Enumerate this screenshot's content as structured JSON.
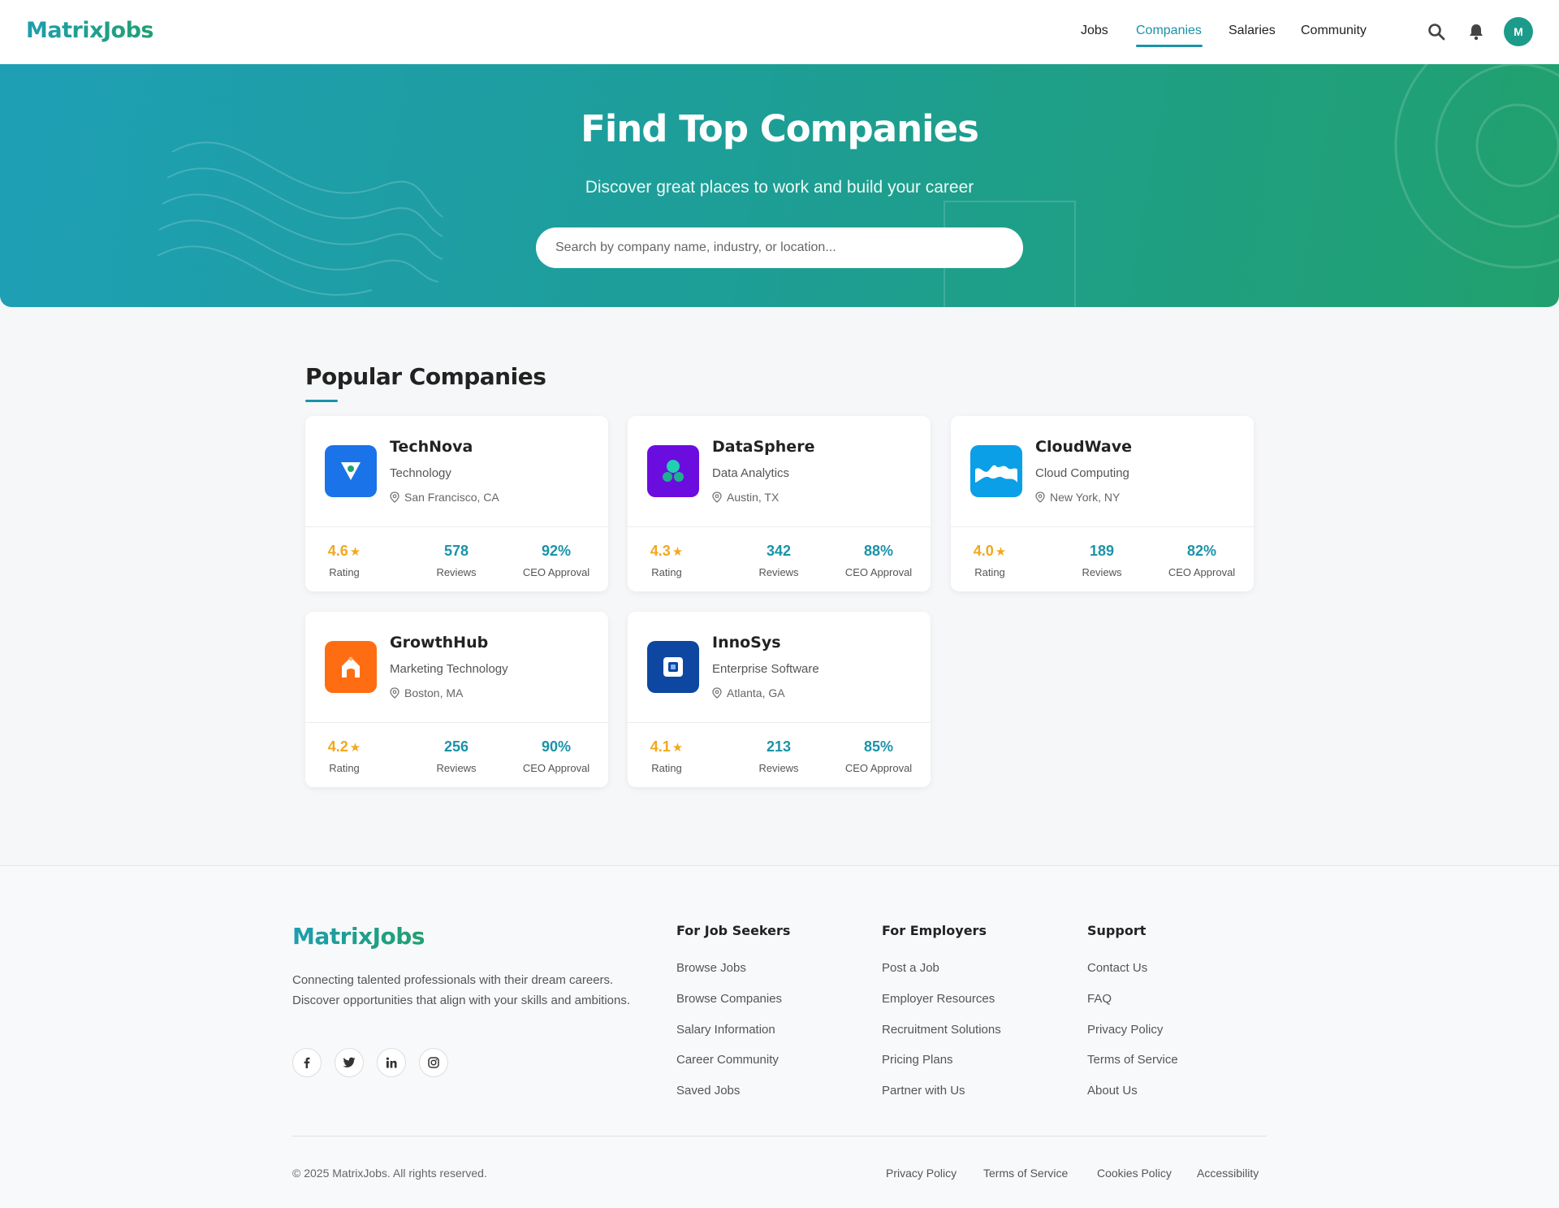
{
  "header": {
    "logo": "MatrixJobs",
    "nav": [
      {
        "label": "Jobs"
      },
      {
        "label": "Companies",
        "active": true
      },
      {
        "label": "Salaries"
      },
      {
        "label": "Community"
      }
    ],
    "icons": [
      "search-icon",
      "bell-icon"
    ],
    "avatar_initial": "M"
  },
  "hero": {
    "title": "Find Top Companies",
    "subtitle": "Discover great places to work and build your career",
    "search_placeholder": "Search by company name, industry, or location..."
  },
  "section": {
    "title": "Popular Companies"
  },
  "companies": [
    {
      "name": "TechNova",
      "industry": "Technology",
      "location": "San Francisco, CA",
      "rating": "4.6",
      "reviews": "578",
      "ceo_approval": "92%",
      "logo_color": "#1a73e8",
      "logo_icon": "v-shield-icon"
    },
    {
      "name": "DataSphere",
      "industry": "Data Analytics",
      "location": "Austin, TX",
      "rating": "4.3",
      "reviews": "342",
      "ceo_approval": "88%",
      "logo_color": "#6a0dde",
      "logo_icon": "molecule-icon"
    },
    {
      "name": "CloudWave",
      "industry": "Cloud Computing",
      "location": "New York, NY",
      "rating": "4.0",
      "reviews": "189",
      "ceo_approval": "82%",
      "logo_color": "#0a9fe6",
      "logo_icon": "wave-icon"
    },
    {
      "name": "GrowthHub",
      "industry": "Marketing Technology",
      "location": "Boston, MA",
      "rating": "4.2",
      "reviews": "256",
      "ceo_approval": "90%",
      "logo_color": "#ff6d12",
      "logo_icon": "house-arch-icon"
    },
    {
      "name": "InnoSys",
      "industry": "Enterprise Software",
      "location": "Atlanta, GA",
      "rating": "4.1",
      "reviews": "213",
      "ceo_approval": "85%",
      "logo_color": "#0d47a1",
      "logo_icon": "square-chip-icon"
    }
  ],
  "labels": {
    "rating": "Rating",
    "reviews": "Reviews",
    "ceo_approval": "CEO Approval",
    "star": "★"
  },
  "footer": {
    "logo": "MatrixJobs",
    "description": "Connecting talented professionals with their dream careers. Discover opportunities that align with your skills and ambitions.",
    "social": [
      "facebook-icon",
      "twitter-icon",
      "linkedin-icon",
      "instagram-icon"
    ],
    "columns": [
      {
        "title": "For Job Seekers",
        "links": [
          "Browse Jobs",
          "Browse Companies",
          "Salary Information",
          "Career Community",
          "Saved Jobs"
        ]
      },
      {
        "title": "For Employers",
        "links": [
          "Post a Job",
          "Employer Resources",
          "Recruitment Solutions",
          "Pricing Plans",
          "Partner with Us"
        ]
      },
      {
        "title": "Support",
        "links": [
          "Contact Us",
          "FAQ",
          "Privacy Policy",
          "Terms of Service",
          "About Us"
        ]
      }
    ],
    "copyright": "© 2025 MatrixJobs. All rights reserved.",
    "legal": [
      "Privacy Policy",
      "Terms of Service",
      "Cookies Policy",
      "Accessibility"
    ]
  }
}
